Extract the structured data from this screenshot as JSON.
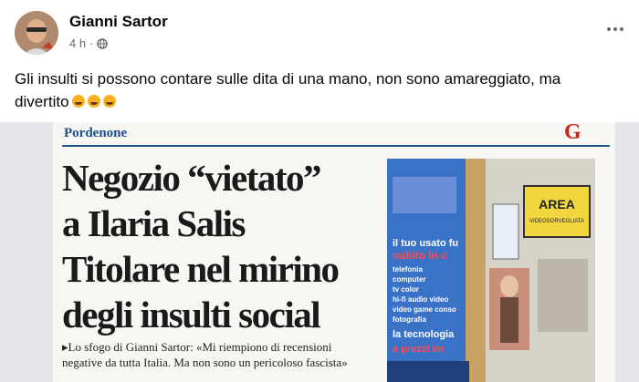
{
  "post": {
    "author": "Gianni Sartor",
    "time": "4 h",
    "separator": "·",
    "text": "Gli insulti si possono contare sulle dita di una mano, non sono amareggiato, ma divertito"
  },
  "icons": {
    "privacy": "globe-icon",
    "more": "more-options-icon",
    "reactions": "rolling-laughing-emoji"
  },
  "clipping": {
    "section": "Pordenone",
    "logo": "G",
    "headline_lines": [
      "Negozio “vietato”",
      "a Ilaria Salis",
      "Titolare nel mirino",
      "degli insulti social"
    ],
    "subhead": "▸Lo sfogo di Gianni Sartor: «Mi riempiono di recensioni negative da tutta Italia. Ma non sono un pericoloso fascista»",
    "shop_sign": {
      "line1": "AREA",
      "line2": "VIDEOSORVEGLIATA"
    },
    "window_text": [
      "il tuo usato fu",
      "subito in c",
      "telefonia",
      "computer",
      "tv color",
      "hi-fi audio video",
      "video game conso",
      "fotografia",
      "la tecnologia",
      "a prezzi im"
    ]
  },
  "colors": {
    "section": "#1c4f8c",
    "logo": "#c5251c",
    "window_blue": "#2f5fb7",
    "sign_yellow": "#f2d63f"
  }
}
